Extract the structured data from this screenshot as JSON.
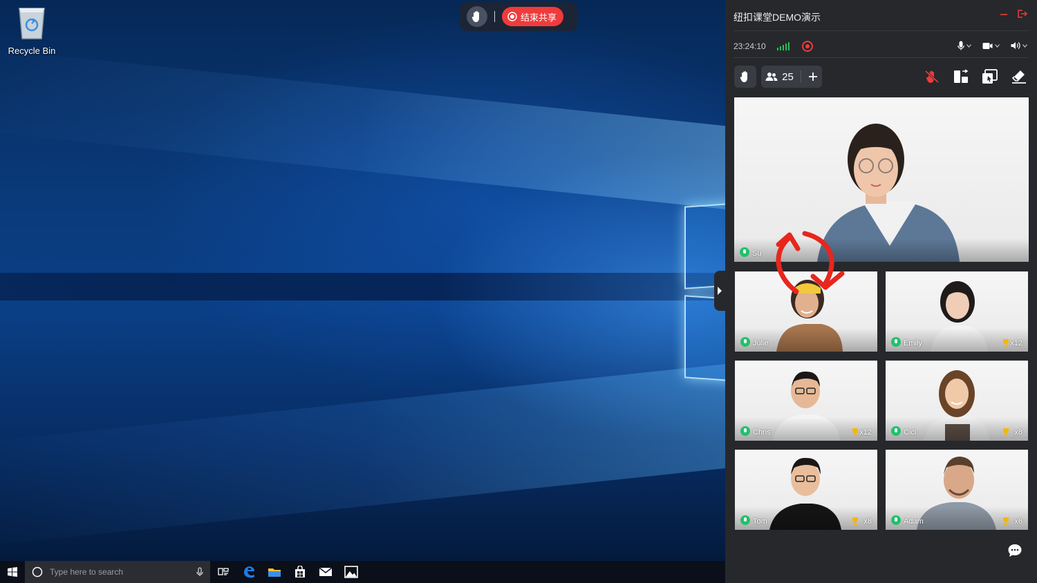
{
  "desktop": {
    "recycle_bin_label": "Recycle Bin"
  },
  "share_toolbar": {
    "end_share_label": "结束共享"
  },
  "taskbar": {
    "search_placeholder": "Type here to search"
  },
  "panel": {
    "title": "纽扣课堂DEMO演示",
    "clock": "23:24:10",
    "participant_count": "25",
    "teacher": {
      "name": "Su"
    },
    "students": [
      {
        "name": "Julie",
        "score": ""
      },
      {
        "name": "Emily",
        "score": "x12"
      },
      {
        "name": "Chris",
        "score": "x12"
      },
      {
        "name": "Cici",
        "score": "x8"
      },
      {
        "name": "Tom",
        "score": "x8"
      },
      {
        "name": "Adam",
        "score": "x6"
      }
    ]
  },
  "colors": {
    "accent_red": "#ef3b3b",
    "mic_green": "#20c26a",
    "signal_green": "#23c256",
    "trophy_gold": "#f5b800",
    "panel_bg": "#27282c"
  }
}
